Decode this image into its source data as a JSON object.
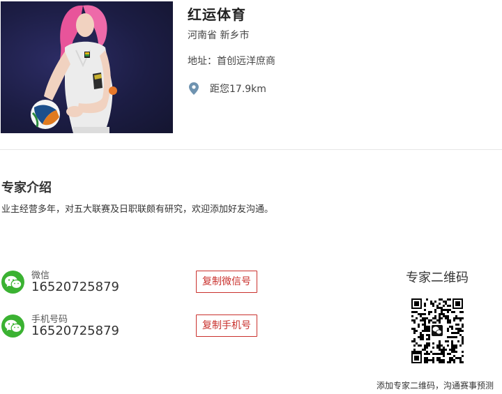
{
  "profile": {
    "title": "红运体育",
    "region": "河南省 新乡市",
    "address": "地址：首创远洋庶商",
    "distance": "距您17.9km",
    "photo_icon": "person-photo"
  },
  "intro": {
    "heading": "专家介绍",
    "text": "业主经营多年，对五大联赛及日职联颇有研究，欢迎添加好友沟通。"
  },
  "contacts": {
    "wechat": {
      "label": "微信",
      "value": "16520725879",
      "button": "复制微信号",
      "icon": "wechat-icon"
    },
    "phone": {
      "label": "手机号码",
      "value": "16520725879",
      "button": "复制手机号",
      "icon": "wechat-icon"
    }
  },
  "qr": {
    "title": "专家二维码",
    "caption": "添加专家二维码，沟通赛事预测"
  },
  "colors": {
    "accent_red": "#c9302c",
    "wechat_green": "#3bb232",
    "pin_blue": "#6f93b0"
  }
}
